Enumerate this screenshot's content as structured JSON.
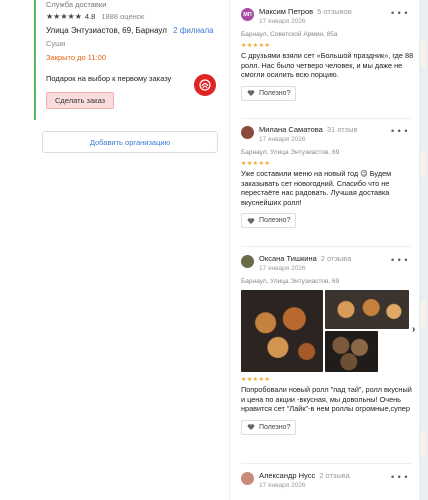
{
  "org": {
    "category": "Служба доставки",
    "rating": "4.8",
    "ratings_count": "1888 оценок",
    "address": "Улица Энтузиастов, 69, Барнаул",
    "branches": "2 филиала",
    "cuisine": "Суши",
    "hours": "Закрыто до 11:00",
    "gift_text": "Подарок на выбор к первому заказу",
    "order_button": "Сделать заказ",
    "stars": "★★★★★"
  },
  "add_org": "Добавить организацию",
  "colors": {
    "accent": "#3a7bd5",
    "open_border": "#5cba63",
    "hours": "#e5600d",
    "brand": "#e02424",
    "stars": "#f5a623"
  },
  "reviews": [
    {
      "initials": "МП",
      "avatar_color": "#a64ca6",
      "name": "Максим Петров",
      "count": "5 отзывов",
      "date": "17 января 2026",
      "branch": "Барнаул, Советской Армии, 85а",
      "stars": "★★★★★",
      "text": "С друзьями взяли сет «Большой праздник», где 88 ролл. Нас было четверо человек, и мы даже не смогли осилить всю порцию.",
      "useful": "Полезно?"
    },
    {
      "initials": "",
      "avatar_color": "#8b4a3c",
      "name": "Милана Саматова",
      "count": "31 отзыв",
      "date": "17 января 2026",
      "branch": "Барнаул, Улица Энтузиастов, 69",
      "stars": "★★★★★",
      "text": "Уже составили меню на новый год 😉 Будем заказывать сет новогодний. Спасибо что не перестаёте нас радовать. Лучшая доставка вкуснейших ролл!",
      "useful": "Полезно?"
    },
    {
      "initials": "",
      "avatar_color": "#6b6b4a",
      "name": "Оксана Тишкина",
      "count": "2 отзыва",
      "date": "17 января 2026",
      "branch": "Барнаул, Улица Энтузиастов, 69",
      "stars": "★★★★★",
      "text": "Попробовали новый ролл \"пад тай\", ролл вкусный и цена по акции -вкусная, мы довольны! Очень нравится сет \"Лайк\"-в нем роллы огромные,супер",
      "useful": "Полезно?"
    },
    {
      "initials": "",
      "avatar_color": "#c98a7a",
      "name": "Александр Нусс",
      "count": "2 отзыва",
      "date": "17 января 2026"
    }
  ],
  "more_label": "⋮",
  "more_dots": "• • •",
  "next_arrow": "›"
}
